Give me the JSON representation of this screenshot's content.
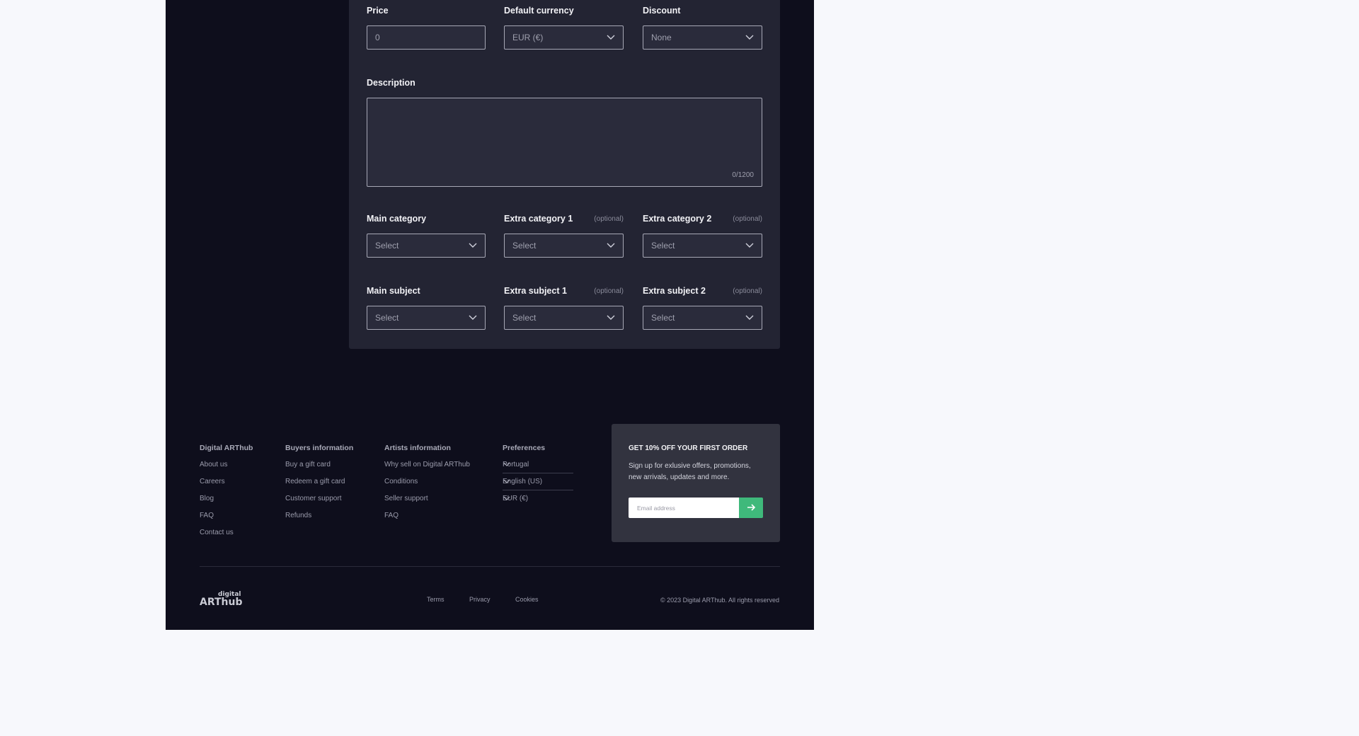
{
  "form": {
    "price": {
      "label": "Price",
      "value": "0"
    },
    "currency": {
      "label": "Default currency",
      "value": "EUR (€)"
    },
    "discount": {
      "label": "Discount",
      "value": "None"
    },
    "description": {
      "label": "Description",
      "counter": "0/1200"
    },
    "main_category": {
      "label": "Main category",
      "value": "Select"
    },
    "extra_category_1": {
      "label": "Extra category 1",
      "optional": "(optional)",
      "value": "Select"
    },
    "extra_category_2": {
      "label": "Extra category 2",
      "optional": "(optional)",
      "value": "Select"
    },
    "main_subject": {
      "label": "Main subject",
      "value": "Select"
    },
    "extra_subject_1": {
      "label": "Extra subject 1",
      "optional": "(optional)",
      "value": "Select"
    },
    "extra_subject_2": {
      "label": "Extra subject 2",
      "optional": "(optional)",
      "value": "Select"
    }
  },
  "footer": {
    "col1": {
      "title": "Digital ARThub",
      "links": [
        "About us",
        "Careers",
        "Blog",
        "FAQ",
        "Contact us"
      ]
    },
    "col2": {
      "title": "Buyers information",
      "links": [
        "Buy a gift card",
        "Redeem a gift card",
        "Customer support",
        "Refunds"
      ]
    },
    "col3": {
      "title": "Artists information",
      "links": [
        "Why sell on Digital ARThub",
        "Conditions",
        "Seller support",
        "FAQ"
      ]
    },
    "preferences": {
      "title": "Preferences",
      "country": "Portugal",
      "language": "English (US)",
      "currency": "EUR (€)"
    },
    "promo": {
      "title": "GET 10% OFF YOUR FIRST ORDER",
      "text": "Sign up for exlusive offers, promotions, new arrivals, updates and more.",
      "email_placeholder": "Email address"
    },
    "logo_text": {
      "line1": "digital",
      "line2": "ARThub"
    },
    "bottom_links": [
      "Terms",
      "Privacy",
      "Cookies"
    ],
    "copyright": "© 2023 Digital ARThub. All rights reserved"
  },
  "colors": {
    "accent": "#3fb97b",
    "panel": "#232433",
    "background": "#0e0e1c"
  }
}
